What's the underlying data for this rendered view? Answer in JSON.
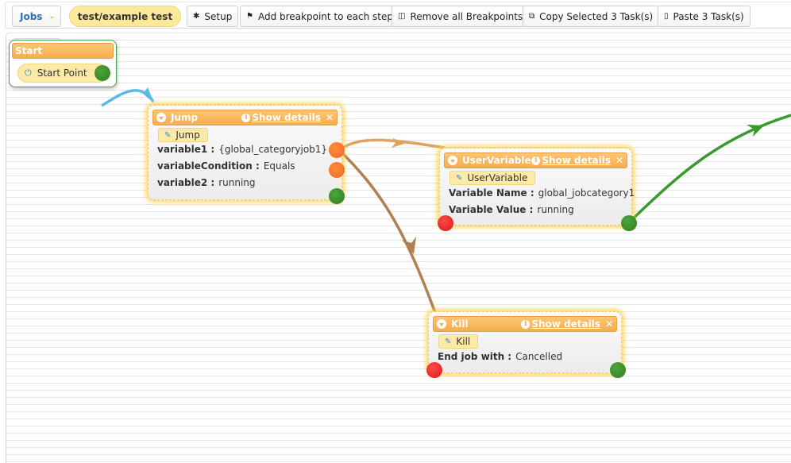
{
  "toolbar": {
    "jobs_menu": "Jobs",
    "job_name": "test/example test",
    "buttons": [
      {
        "icon": "gear-icon",
        "glyph": "✱",
        "label": "Setup"
      },
      {
        "icon": "flag-icon",
        "glyph": "⚑",
        "label": "Add breakpoint to each step"
      },
      {
        "icon": "trash-icon",
        "glyph": "🗑",
        "label": "Remove all Breakpoints"
      },
      {
        "icon": "copy-icon",
        "glyph": "⧉",
        "label": "Copy Selected 3 Task(s)"
      },
      {
        "icon": "paste-icon",
        "glyph": "📋",
        "label": "Paste 3 Task(s)"
      }
    ]
  },
  "palette": {
    "icon": "add-task-icon"
  },
  "colors": {
    "header_orange": "#f6ad4c",
    "tag_yellow": "#fdeaa6",
    "port_orange": "#f06a1c",
    "port_green": "#3a8f2c",
    "port_red": "#e02020",
    "wire_blue": "#5bb9e6",
    "wire_tan": "#e0a35f",
    "wire_brown": "#b08050",
    "wire_green": "#3a9a2e",
    "start_border": "#3fa35a"
  },
  "nodes": {
    "start": {
      "title": "Start",
      "point_label": "Start Point"
    },
    "jump": {
      "title": "Jump",
      "show_details": "Show details",
      "close": "✕",
      "tag": "Jump",
      "props": [
        {
          "key": "variable1 :",
          "value": "{global_categoryjob1}"
        },
        {
          "key": "variableCondition :",
          "value": "Equals"
        },
        {
          "key": "variable2 :",
          "value": "running"
        }
      ]
    },
    "user_variable": {
      "title": "UserVariable",
      "show_details": "Show details",
      "close": "✕",
      "tag": "UserVariable",
      "props": [
        {
          "key": "Variable Name :",
          "value": "global_jobcategory1"
        },
        {
          "key": "Variable Value :",
          "value": "running"
        }
      ]
    },
    "kill": {
      "title": "Kill",
      "show_details": "Show details",
      "close": "✕",
      "tag": "Kill",
      "props": [
        {
          "key": "End job with :",
          "value": "Cancelled"
        }
      ]
    }
  },
  "connections": [
    {
      "from": "start",
      "to": "jump",
      "color": "wire_blue"
    },
    {
      "from": "jump.true",
      "to": "user_variable",
      "color": "wire_tan"
    },
    {
      "from": "jump.true",
      "to": "kill",
      "color": "wire_brown"
    },
    {
      "from": "user_variable.success",
      "to": "offscreen",
      "color": "wire_green"
    }
  ]
}
